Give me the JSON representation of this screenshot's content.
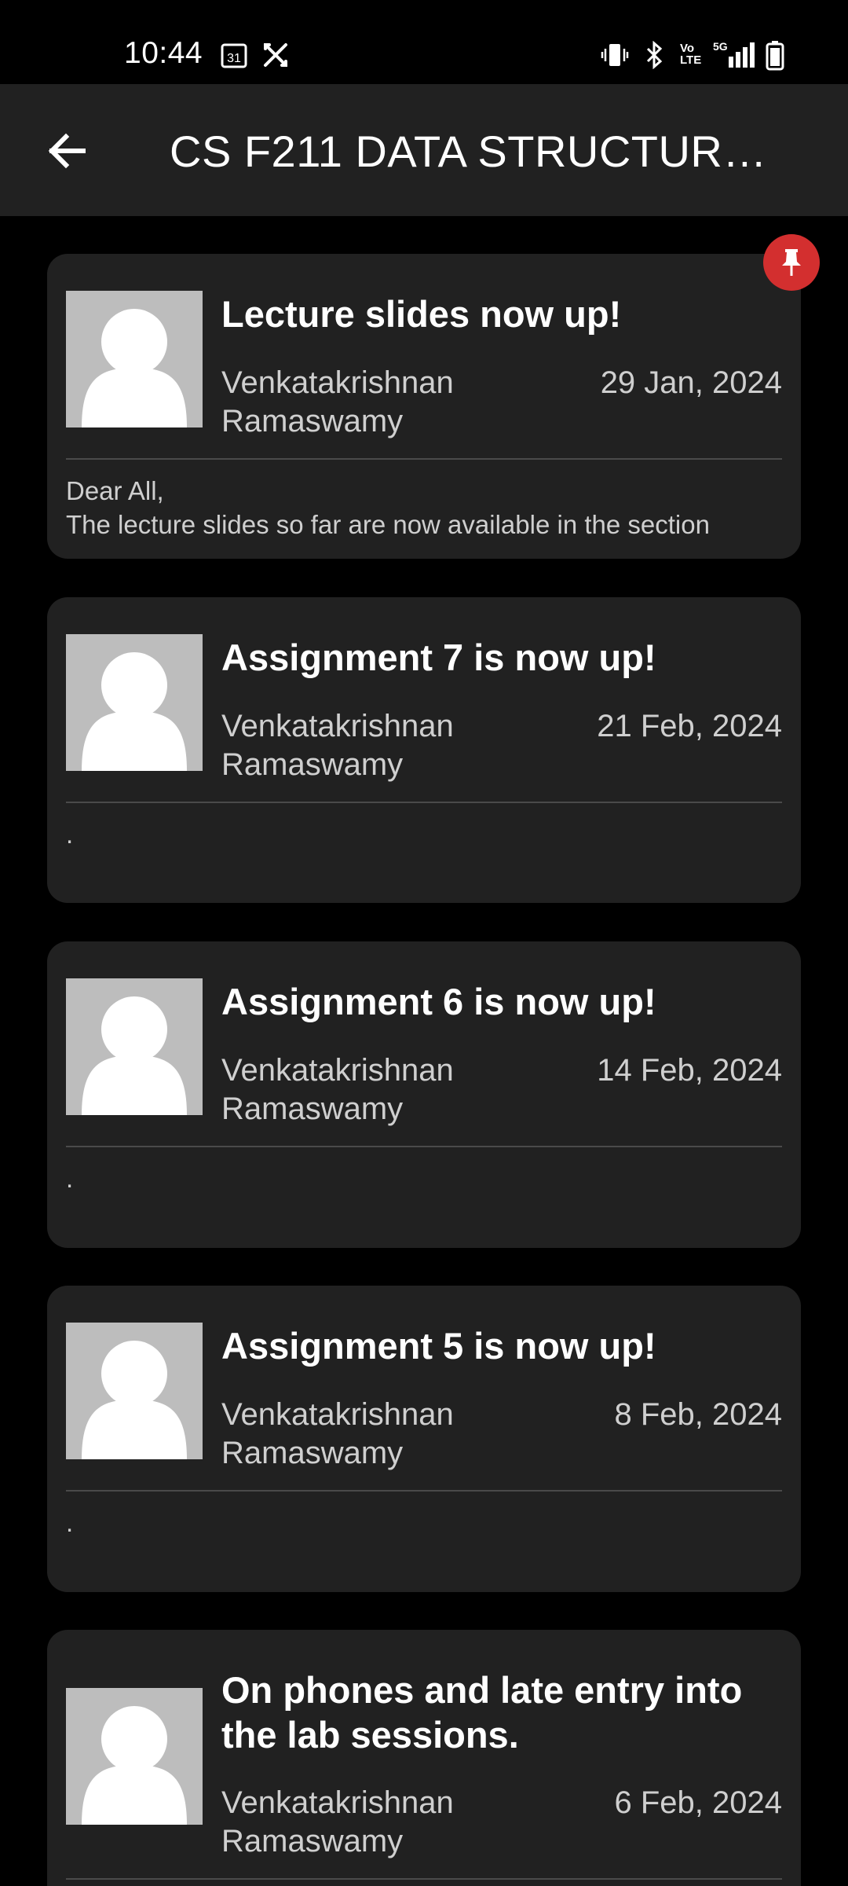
{
  "status_bar": {
    "time": "10:44",
    "left_icons": [
      "calendar-icon",
      "shuffle-icon"
    ],
    "right_icons": [
      "vibrate-icon",
      "bluetooth-icon",
      "volte-icon",
      "5g-signal-icon",
      "battery-icon"
    ],
    "calendar_day": "31",
    "volte_label": "Vo LTE",
    "network_label": "5G"
  },
  "app_bar": {
    "title": "CS F211 DATA STRUCTUR…",
    "back_icon": "arrow-left-icon"
  },
  "pin_icon": "pushpin-icon",
  "colors": {
    "background": "#000000",
    "card": "#212121",
    "accent_pin": "#d32f2f",
    "avatar_bg": "#bdbdbd"
  },
  "announcements": [
    {
      "title": "Lecture slides now up!",
      "author": "Venkatakrishnan Ramaswamy",
      "date": "29 Jan, 2024",
      "body": "Dear All,\nThe lecture slides so far are now available in the section",
      "pinned": true
    },
    {
      "title": "Assignment 7 is now up!",
      "author": "Venkatakrishnan Ramaswamy",
      "date": "21 Feb, 2024",
      "body": "."
    },
    {
      "title": "Assignment 6 is now up!",
      "author": "Venkatakrishnan Ramaswamy",
      "date": "14 Feb, 2024",
      "body": "."
    },
    {
      "title": "Assignment 5 is now up!",
      "author": "Venkatakrishnan Ramaswamy",
      "date": "8 Feb, 2024",
      "body": "."
    },
    {
      "title": "On phones and late entry into the lab sessions.",
      "author": "Venkatakrishnan Ramaswamy",
      "date": "6 Feb, 2024",
      "body": ""
    }
  ]
}
